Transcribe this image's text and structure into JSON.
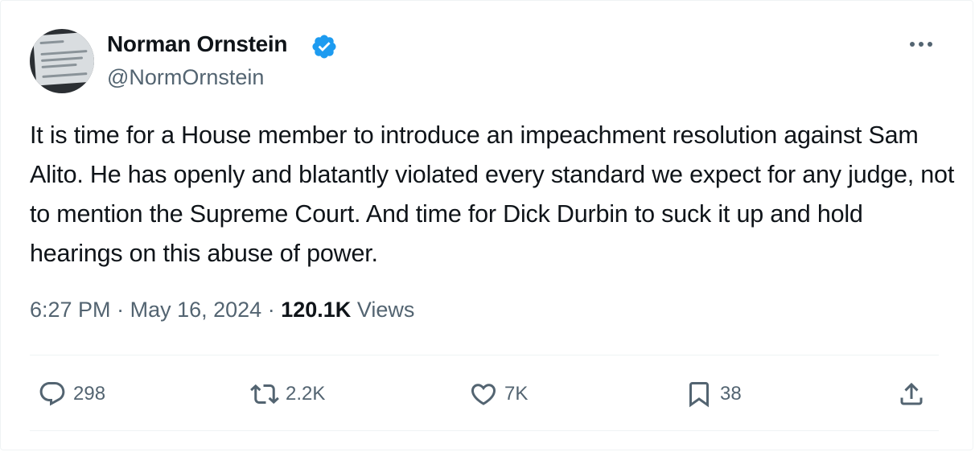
{
  "tweet": {
    "author": {
      "name": "Norman Ornstein",
      "handle": "@NormOrnstein",
      "verified_color": "#1d9bf0"
    },
    "text": "It is time for a House member to introduce an impeachment resolution against Sam Alito. He has openly and blatantly violated every standard we expect for any judge, not to mention the Supreme Court. And time for Dick Durbin to suck it up and hold hearings on this abuse of power.",
    "time": "6:27 PM",
    "separator": "·",
    "date": "May 16, 2024",
    "views_count": "120.1K",
    "views_label": "Views"
  },
  "actions": {
    "replies": "298",
    "reposts": "2.2K",
    "likes": "7K",
    "bookmarks": "38"
  },
  "icons": {
    "more": "more-horizontal-icon",
    "reply": "reply-bubble-icon",
    "repost": "repost-icon",
    "like": "heart-icon",
    "bookmark": "bookmark-icon",
    "share": "share-upload-icon"
  }
}
